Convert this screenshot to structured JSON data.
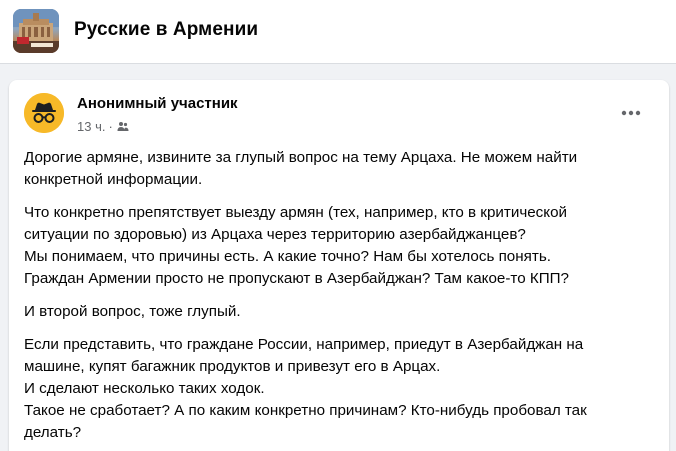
{
  "group": {
    "name": "Русские в Армении",
    "thumbnail_icon": "group-photo-icon"
  },
  "post": {
    "author": "Анонимный участник",
    "avatar_icon": "anonymous-incognito-icon",
    "avatar_color": "#f7b928",
    "time": "13 ч.",
    "separator": "·",
    "privacy_icon": "group-privacy-icon",
    "more_icon": "more-horizontal-icon",
    "paragraphs": [
      [
        "Дорогие армяне, извините за глупый вопрос на тему Арцаха. Не можем найти",
        "конкретной информации."
      ],
      [
        "Что конкретно препятствует выезду армян (тех, например, кто в критической",
        "ситуации по здоровью) из Арцаха через территорию азербайджанцев?",
        "Мы понимаем, что причины есть. А какие точно? Нам бы хотелось понять.",
        "Граждан Армении просто не пропускают в Азербайджан? Там какое-то КПП?"
      ],
      [
        "И второй вопрос, тоже глупый."
      ],
      [
        "Если представить, что граждане России, например, приедут в Азербайджан на",
        "машине, купят багажник продуктов и привезут его в Арцах.",
        "И сделают несколько таких ходок.",
        "Такое не сработает? А по каким конкретно причинам? Кто-нибудь пробовал так",
        "делать?"
      ]
    ]
  },
  "colors": {
    "page_background": "#f0f2f5",
    "card_background": "#ffffff",
    "primary_text": "#050505",
    "secondary_text": "#65676b"
  }
}
